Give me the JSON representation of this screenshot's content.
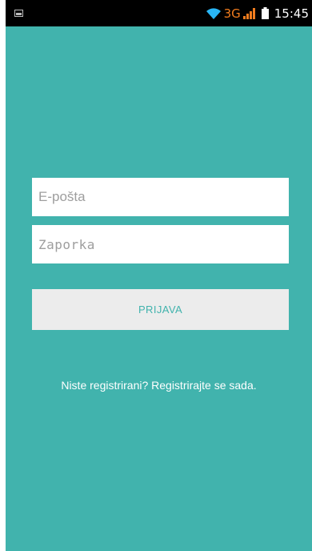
{
  "status_bar": {
    "network_type": "3G",
    "time": "15:45",
    "icons": [
      "notification-icon",
      "wifi-icon",
      "signal-icon",
      "battery-icon"
    ],
    "network_color": "#f07c1e"
  },
  "login": {
    "email_placeholder": "E-pošta",
    "email_value": "",
    "password_placeholder": "Zaporka",
    "password_value": "",
    "submit_label": "PRIJAVA",
    "register_text": "Niste registrirani? Registrirajte se sada."
  },
  "colors": {
    "background": "#41b3ad",
    "button_background": "#ececec",
    "button_text": "#41b3ad",
    "status_bar": "#000000"
  }
}
